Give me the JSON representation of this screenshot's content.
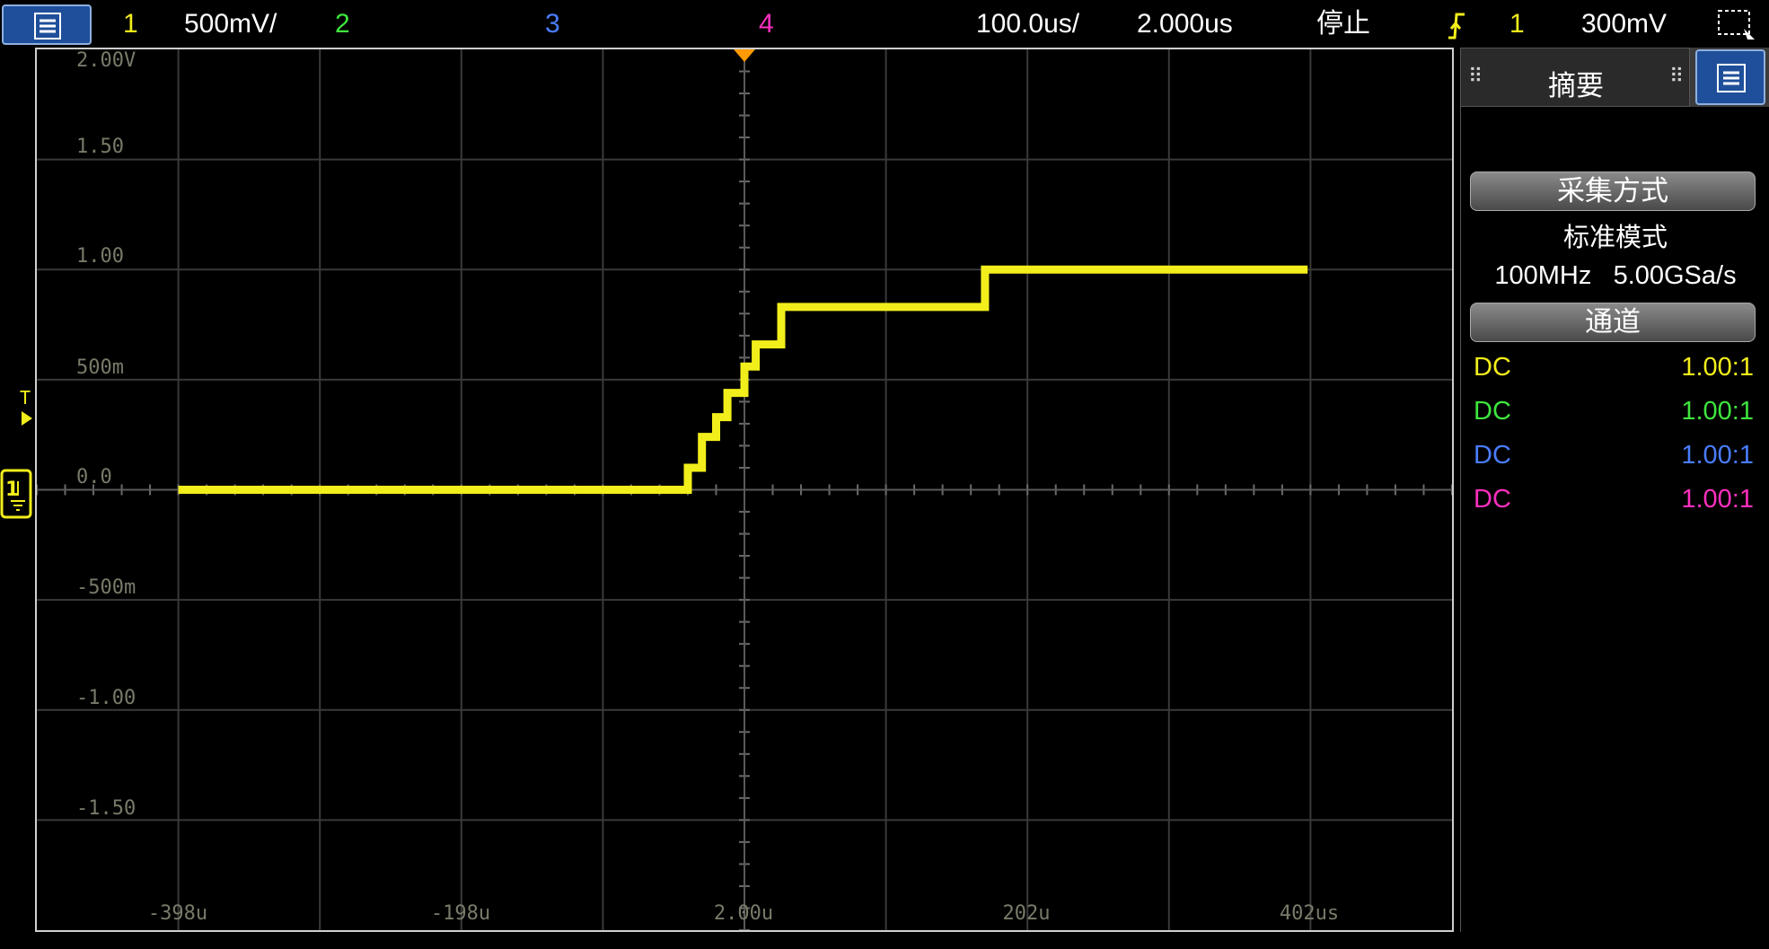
{
  "topbar": {
    "ch1_label": "1",
    "ch1_scale": "500mV/",
    "ch2_label": "2",
    "ch3_label": "3",
    "ch4_label": "4",
    "time_scale": "100.0us/",
    "time_delay": "2.000us",
    "run_state": "停止",
    "trigger_source": "1",
    "trigger_level": "300mV"
  },
  "colors": {
    "ch1": "#f2ee1b",
    "ch2": "#3ee63e",
    "ch3": "#4a7dff",
    "ch4": "#ff2fbf",
    "trigger_marker": "#ff9a00",
    "grid": "#3a3a3a"
  },
  "screen": {
    "volt_labels": [
      "2.00V",
      "1.50",
      "1.00",
      "500m",
      "0.0",
      "-500m",
      "-1.00",
      "-1.50"
    ],
    "time_labels": [
      "-398u",
      "-198u",
      "2.00u",
      "202u",
      "402us"
    ]
  },
  "chart_data": {
    "type": "line",
    "series": [
      {
        "name": "1",
        "x": [
          -398,
          -38,
          -38,
          -28,
          -28,
          -18,
          -18,
          -10,
          -10,
          -6,
          -6,
          2,
          2,
          10,
          10,
          18,
          18,
          28,
          28,
          72,
          72,
          172,
          172,
          400
        ],
        "y": [
          0.0,
          0.0,
          0.1,
          0.1,
          0.24,
          0.24,
          0.33,
          0.33,
          0.44,
          0.44,
          0.44,
          0.44,
          0.56,
          0.56,
          0.66,
          0.66,
          0.66,
          0.66,
          0.83,
          0.83,
          0.83,
          0.83,
          1.0,
          1.0
        ]
      }
    ],
    "xunit": "us",
    "xlim": [
      -498,
      502
    ],
    "ylim": [
      -2.0,
      2.0
    ],
    "grid": true
  },
  "panel": {
    "title": "摘要",
    "acq_header": "采集方式",
    "acq_mode": "标准模式",
    "bandwidth": "100MHz",
    "sample_rate": "5.00GSa/s",
    "channel_header": "通道",
    "channels": [
      {
        "coupling": "DC",
        "probe": "1.00:1"
      },
      {
        "coupling": "DC",
        "probe": "1.00:1"
      },
      {
        "coupling": "DC",
        "probe": "1.00:1"
      },
      {
        "coupling": "DC",
        "probe": "1.00:1"
      }
    ]
  }
}
